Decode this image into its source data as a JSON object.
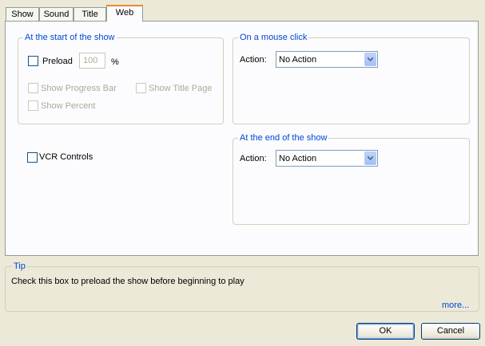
{
  "tabs": [
    {
      "label": "Show"
    },
    {
      "label": "Sound"
    },
    {
      "label": "Title"
    },
    {
      "label": "Web",
      "active": true
    }
  ],
  "start_group": {
    "title": "At the start of the show",
    "preload_label": "Preload",
    "preload_checked": false,
    "preload_value": "100",
    "percent_symbol": "%",
    "show_progress_bar_label": "Show Progress Bar",
    "show_title_page_label": "Show Title Page",
    "show_percent_label": "Show Percent"
  },
  "vcr_controls_label": "VCR Controls",
  "mouse_click_group": {
    "title": "On a mouse click",
    "action_label": "Action:",
    "action_value": "No Action"
  },
  "end_group": {
    "title": "At the end of the show",
    "action_label": "Action:",
    "action_value": "No Action"
  },
  "tip": {
    "title": "Tip",
    "text": "Check this box to preload the show before beginning to play",
    "more_link": "more..."
  },
  "buttons": {
    "ok": "OK",
    "cancel": "Cancel"
  },
  "colors": {
    "dialog_bg": "#ece9d8",
    "panel_bg": "#fcfcfe",
    "group_title": "#0046d5",
    "active_tab_accent": "#e68b2c"
  }
}
